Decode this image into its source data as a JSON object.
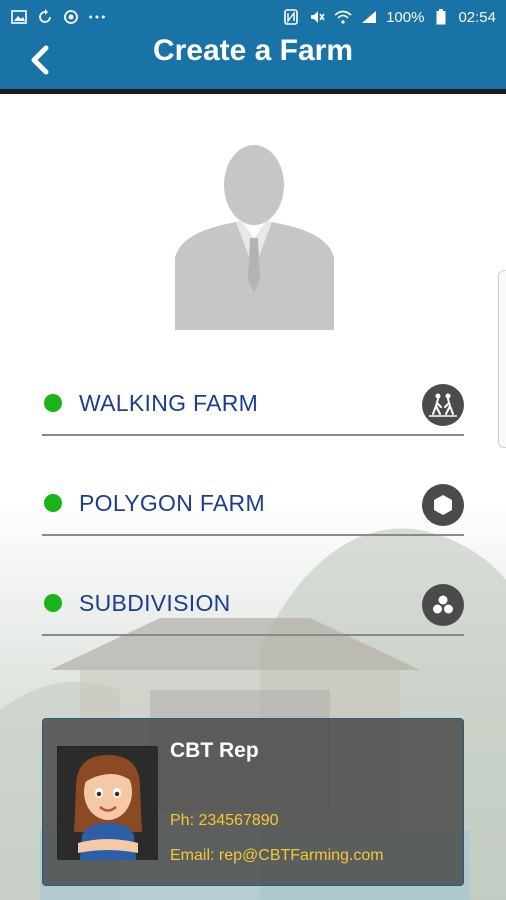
{
  "status_bar": {
    "battery": "100%",
    "time": "02:54",
    "icons_left": [
      "gallery-icon",
      "sync-icon",
      "location-icon",
      "more-dots-icon"
    ],
    "icons_right": [
      "nfc-icon",
      "mute-icon",
      "wifi-icon",
      "signal-icon",
      "battery-icon"
    ]
  },
  "app_bar": {
    "title": "Create a Farm",
    "back_icon": "chevron-left-icon"
  },
  "farm_options": [
    {
      "label": "WALKING FARM",
      "icon": "walking-icon"
    },
    {
      "label": "POLYGON FARM",
      "icon": "hexagon-icon"
    },
    {
      "label": "SUBDIVISION",
      "icon": "subdivision-icon"
    }
  ],
  "rep": {
    "name": "CBT Rep",
    "phone": "Ph: 234567890",
    "email": "Email: rep@CBTFarming.com"
  },
  "colors": {
    "primary": "#1a73a6",
    "option_text": "#1b3e8f",
    "status_dot": "#18b418",
    "contact_text": "#f6c830"
  }
}
